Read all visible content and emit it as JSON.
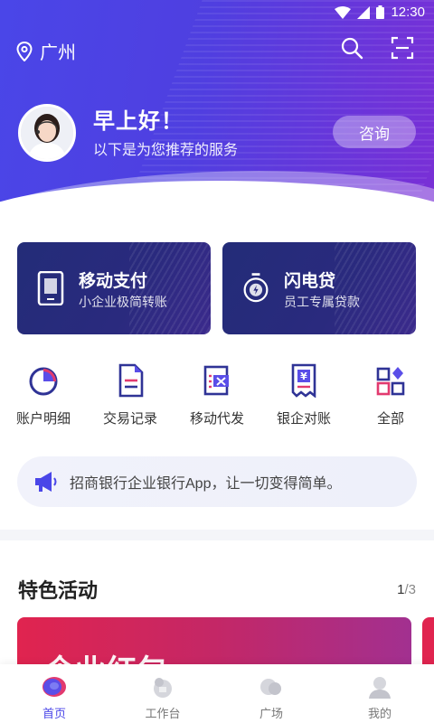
{
  "status": {
    "time": "12:30"
  },
  "header": {
    "city": "广州"
  },
  "greeting": {
    "title": "早上好！",
    "subtitle": "以下是为您推荐的服务",
    "consult": "咨询"
  },
  "cards": [
    {
      "title": "移动支付",
      "subtitle": "小企业极简转账",
      "icon": "phone-pay-icon"
    },
    {
      "title": "闪电贷",
      "subtitle": "员工专属贷款",
      "icon": "lightning-loan-icon"
    }
  ],
  "quick_actions": [
    {
      "label": "账户明细",
      "icon": "pie-chart-icon"
    },
    {
      "label": "交易记录",
      "icon": "document-icon"
    },
    {
      "label": "移动代发",
      "icon": "excel-sheet-icon"
    },
    {
      "label": "银企对账",
      "icon": "yuan-receipt-icon"
    },
    {
      "label": "全部",
      "icon": "grid-icon"
    }
  ],
  "notice": {
    "text": "招商银行企业银行App，让一切变得简单。"
  },
  "section": {
    "title": "特色活动",
    "page_current": "1",
    "page_total": "/3"
  },
  "banner": {
    "text": "企业红包"
  },
  "nav": [
    {
      "label": "首页",
      "active": true
    },
    {
      "label": "工作台"
    },
    {
      "label": "广场"
    },
    {
      "label": "我的"
    }
  ],
  "colors": {
    "primary": "#4a46e8",
    "card_dark": "#232c78",
    "banner_red": "#e0244f"
  }
}
